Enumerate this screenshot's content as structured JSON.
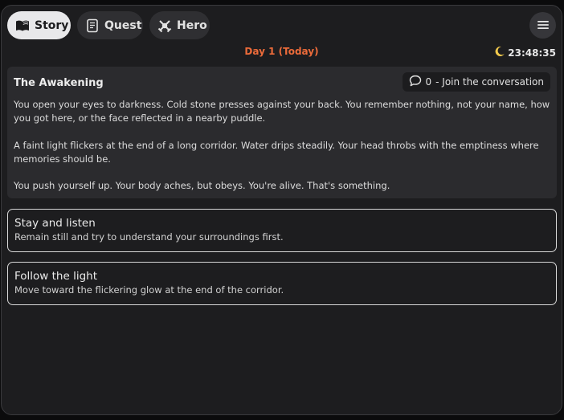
{
  "tabs": [
    {
      "label": "Story",
      "icon": "book-icon",
      "active": true
    },
    {
      "label": "Quest",
      "icon": "scroll-icon",
      "active": false
    },
    {
      "label": "Hero",
      "icon": "crossed-swords-icon",
      "active": false
    }
  ],
  "menu": {
    "icon": "hamburger-menu-icon"
  },
  "day": {
    "label": "Day 1 (Today)",
    "color": "#ec6b3a"
  },
  "clock": {
    "icon": "moon-icon",
    "time": "23:48:35"
  },
  "story": {
    "title": "The Awakening",
    "conversation": {
      "count": "0",
      "label": "- Join the conversation",
      "icon": "speech-bubble-icon"
    },
    "paragraphs": [
      "You open your eyes to darkness. Cold stone presses against your back. You remember nothing, not your name, how you got here, or the face reflected in a nearby puddle.",
      "A faint light flickers at the end of a long corridor. Water drips steadily. Your head throbs with the emptiness where memories should be.",
      "You push yourself up. Your body aches, but obeys. You're alive. That's something."
    ]
  },
  "choices": [
    {
      "title": "Stay and listen",
      "description": "Remain still and try to understand your surroundings first."
    },
    {
      "title": "Follow the light",
      "description": "Move toward the flickering glow at the end of the corridor."
    }
  ]
}
